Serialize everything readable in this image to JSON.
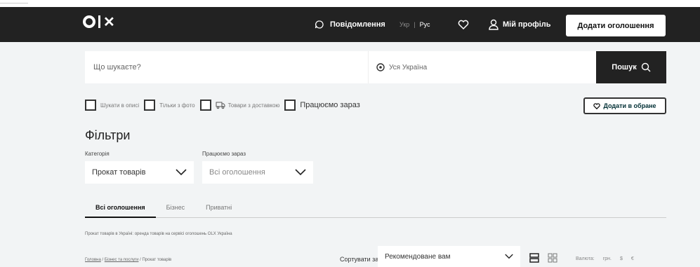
{
  "header": {
    "logo": "olx",
    "messages_label": "Повідомлення",
    "lang_ukr": "Укр",
    "lang_sep": "|",
    "lang_rus": "Рус",
    "profile_label": "Мій профіль",
    "add_ad_label": "Додати оголошення"
  },
  "search": {
    "query_placeholder": "Що шукаєте?",
    "location_value": "Уся Україна",
    "button_label": "Пошук"
  },
  "checkboxes": [
    {
      "label": "Шукати в описі"
    },
    {
      "label": "Тільки з фото"
    },
    {
      "label": "Товари з доставкою"
    },
    {
      "label": "Працюємо зараз"
    }
  ],
  "favorite_label": "Додати в обране",
  "filters": {
    "title": "Фільтри",
    "category_label": "Категорія",
    "category_value": "Прокат товарів",
    "working_label": "Працюємо зараз",
    "working_value": "Всі оголошення"
  },
  "tabs": [
    {
      "label": "Всі оголошення"
    },
    {
      "label": "Бізнес"
    },
    {
      "label": "Приватні"
    }
  ],
  "description": "Прокат товарів в Україні: оренда товарів на сервісі оголошень OLX Україна",
  "breadcrumb": {
    "home": "Головна",
    "sep1": " / ",
    "business": "Бізнес та послуги",
    "sep2": " / ",
    "current": "Прокат товарів"
  },
  "sort": {
    "label": "Сортувати за:",
    "value": "Рекомендоване вам"
  },
  "currency": {
    "label": "Валюта:",
    "options": [
      "грн.",
      "$",
      "€"
    ]
  }
}
